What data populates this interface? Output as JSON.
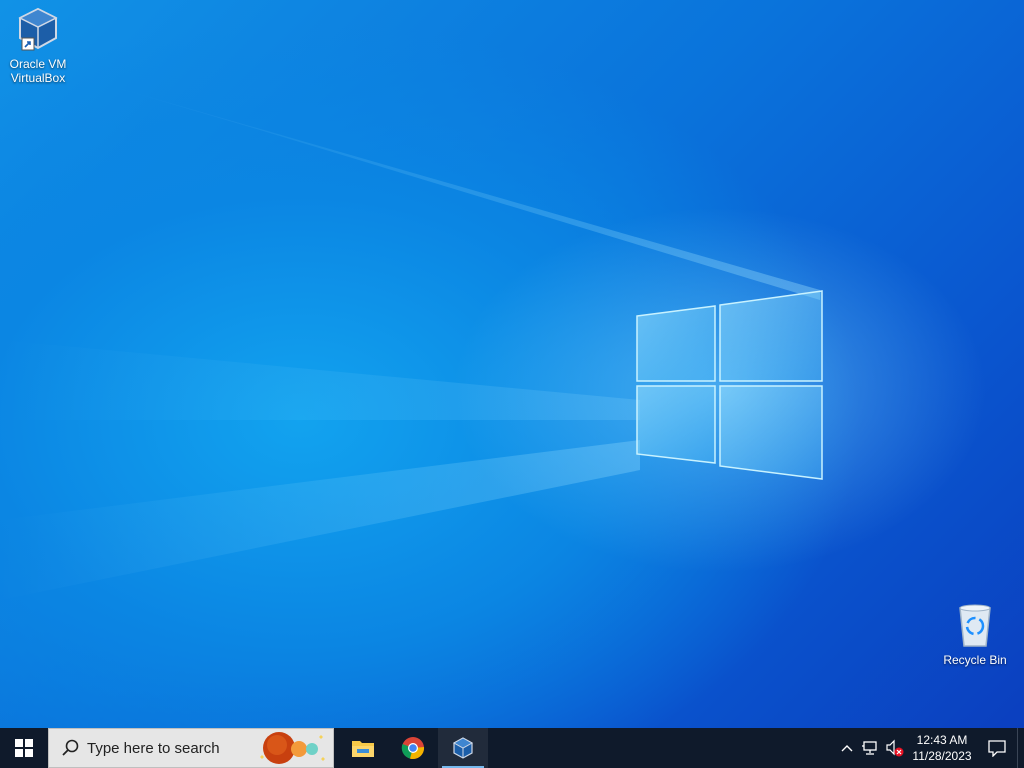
{
  "desktop": {
    "icons": [
      {
        "label_line1": "Oracle VM",
        "label_line2": "VirtualBox",
        "icon": "virtualbox-icon"
      },
      {
        "label": "Recycle Bin",
        "icon": "recycle-bin-icon"
      }
    ]
  },
  "taskbar": {
    "start_icon": "windows-start-icon",
    "search": {
      "placeholder": "Type here to search",
      "icon": "search-icon"
    },
    "apps": [
      {
        "name": "File Explorer",
        "icon": "file-explorer-icon"
      },
      {
        "name": "Google Chrome",
        "icon": "chrome-icon"
      },
      {
        "name": "Oracle VM VirtualBox",
        "icon": "virtualbox-icon",
        "active": true
      }
    ],
    "tray": {
      "chevron_icon": "chevron-up-icon",
      "network_icon": "network-icon",
      "volume_icon": "volume-muted-icon",
      "time": "12:43 AM",
      "date": "11/28/2023",
      "notification_icon": "notification-icon"
    }
  },
  "colors": {
    "taskbar_bg": "#0f1a2b",
    "desktop_blue": "#0a73db",
    "accent": "#76b9ed"
  }
}
